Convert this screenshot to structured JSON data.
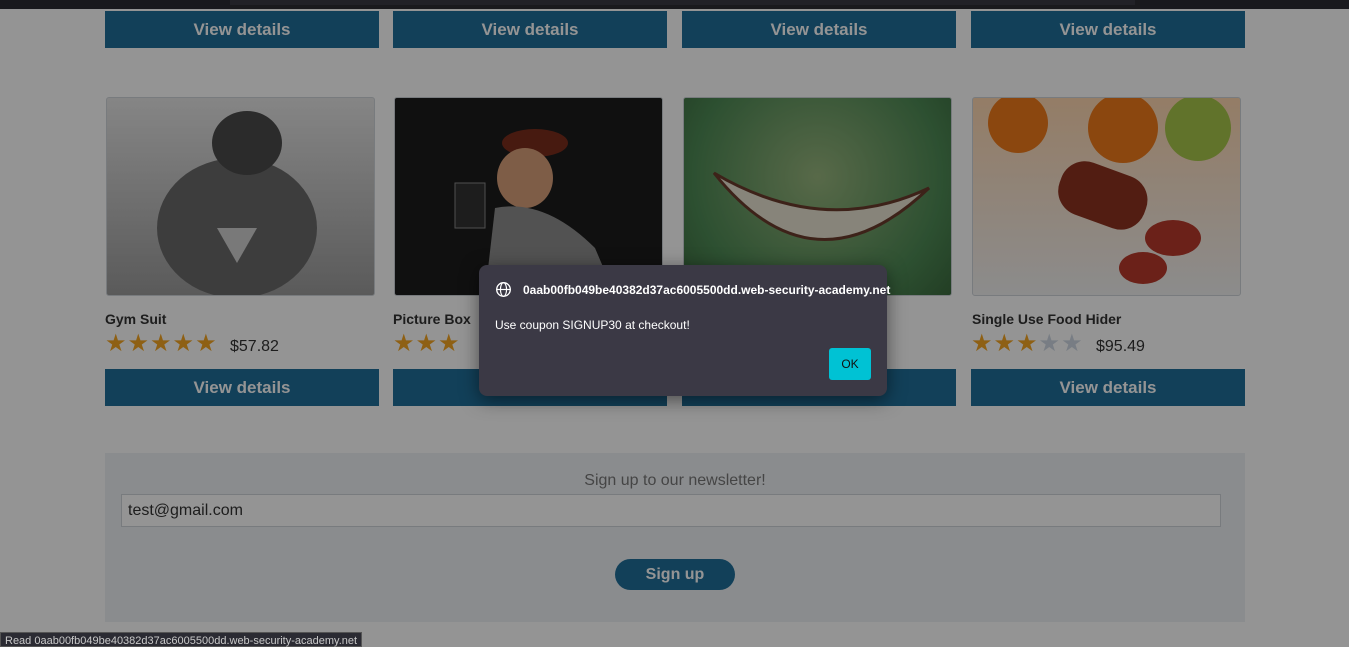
{
  "top_buttons": [
    "View details",
    "View details",
    "View details",
    "View details"
  ],
  "products": [
    {
      "name": "Gym Suit",
      "rating": 5,
      "price": "$57.82",
      "button": "View details",
      "image": "gym-suit-image"
    },
    {
      "name": "Picture Box",
      "rating": 3,
      "price": "",
      "button": "View details",
      "image": "picture-box-image"
    },
    {
      "name": "",
      "rating": 0,
      "price": "",
      "button": "View details",
      "image": "grin-image"
    },
    {
      "name": "Single Use Food Hider",
      "rating": 3,
      "price": "$95.49",
      "button": "View details",
      "image": "food-hider-image"
    }
  ],
  "newsletter": {
    "title": "Sign up to our newsletter!",
    "email_value": "test@gmail.com",
    "signup_label": "Sign up"
  },
  "dialog": {
    "origin": "0aab00fb049be40382d37ac6005500dd.web-security-academy.net",
    "message": "Use coupon SIGNUP30 at checkout!",
    "ok_label": "OK"
  },
  "status_bar": "Read 0aab00fb049be40382d37ac6005500dd.web-security-academy.net",
  "colors": {
    "button": "#1f6f9a",
    "star": "#f5a623",
    "ok": "#00c2d4"
  }
}
